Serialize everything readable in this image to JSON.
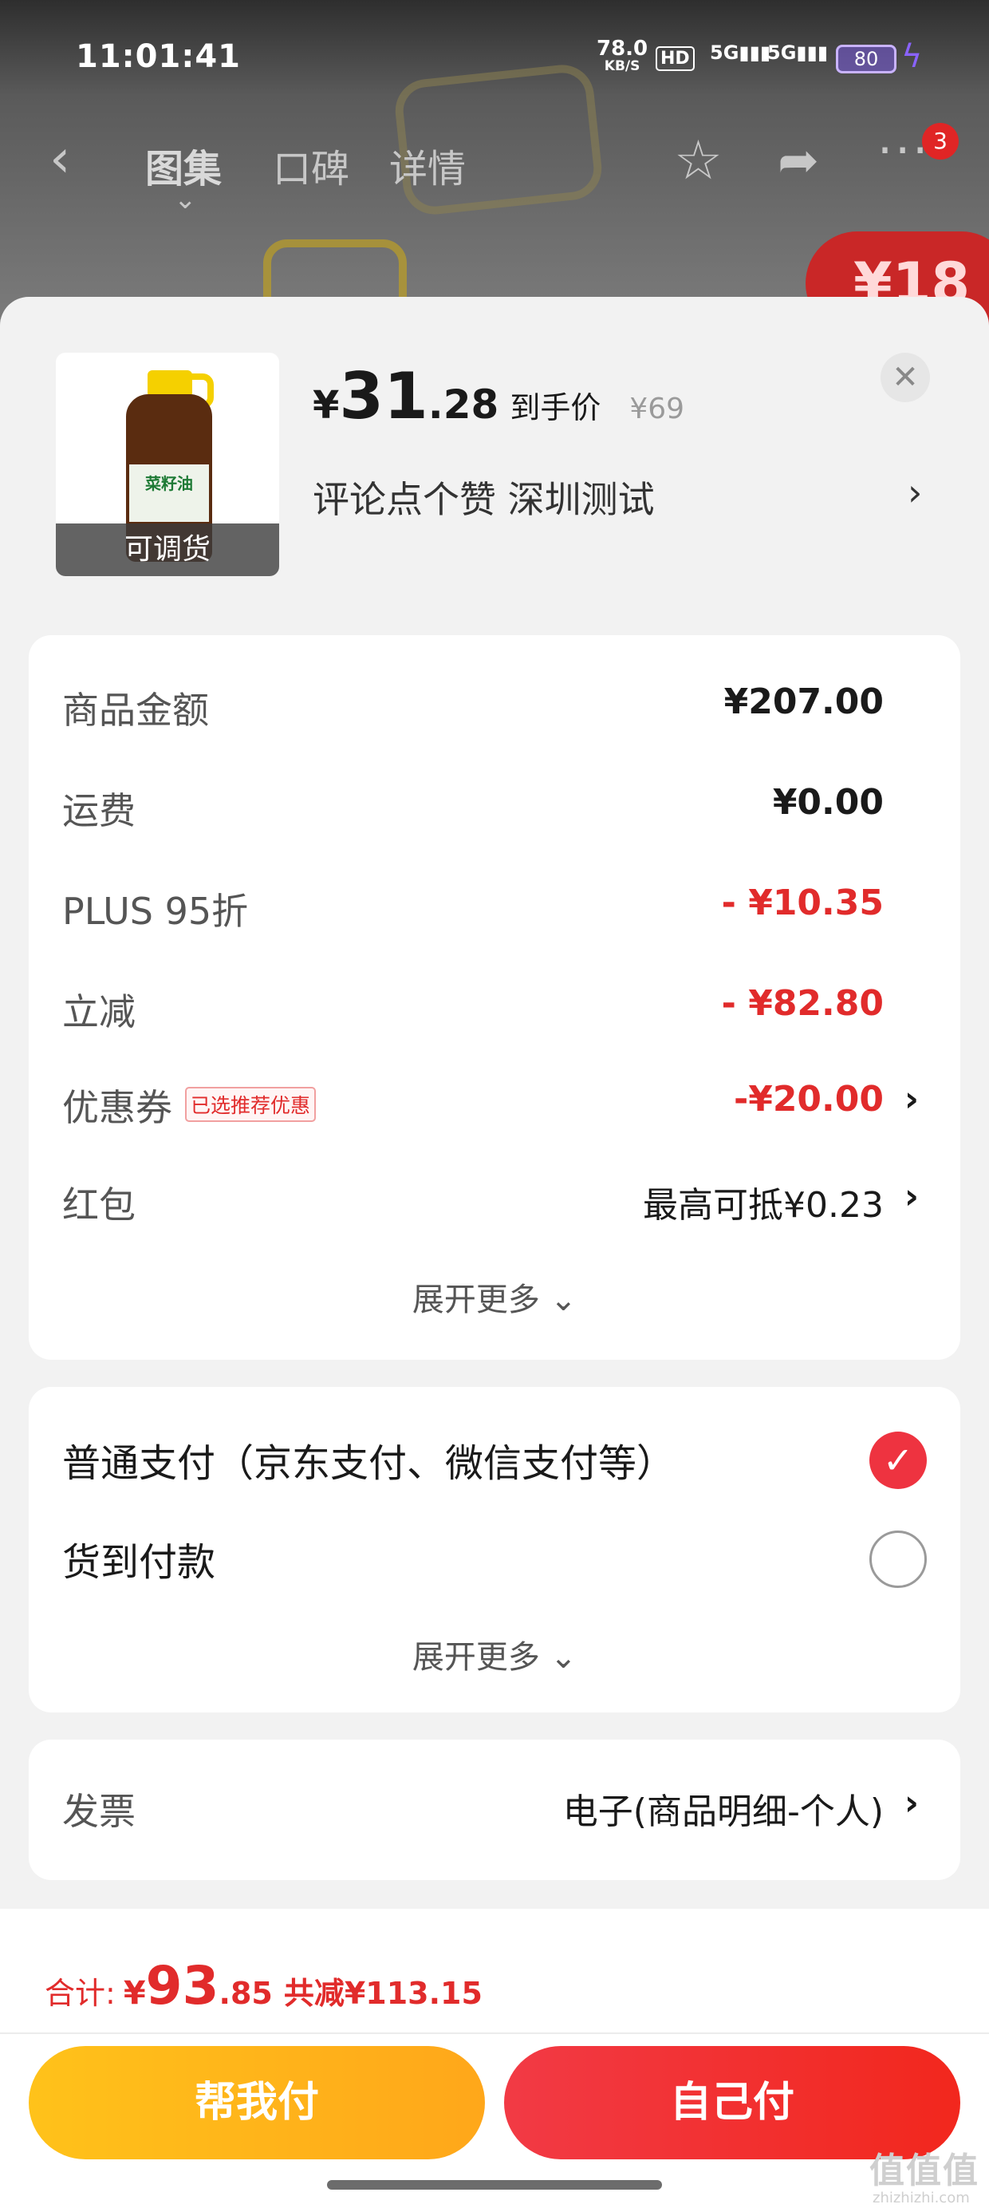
{
  "status_bar": {
    "time": "11:01:41",
    "net_speed": "78.0",
    "net_unit": "KB/S",
    "hd": "HD",
    "signal1": "5G",
    "signal2": "5G",
    "battery": "80"
  },
  "nav": {
    "tabs": [
      {
        "label": "图集"
      },
      {
        "label": "口碑"
      },
      {
        "label": "详情"
      }
    ],
    "badge_count": "3",
    "bg_promo": "¥18"
  },
  "product": {
    "thumb_caption": "可调货",
    "thumb_brand": "菜籽油",
    "price_symbol": "¥",
    "price_int": "31",
    "price_dec": ".28",
    "price_tag": "到手价",
    "original_price": "¥69",
    "address": "评论点个赞  深圳测试"
  },
  "breakdown": {
    "rows": [
      {
        "label": "商品金额",
        "value": "¥207.00"
      },
      {
        "label": "运费",
        "value": "¥0.00"
      },
      {
        "label": "PLUS 95折",
        "value": "- ¥10.35"
      },
      {
        "label": "立减",
        "value": "- ¥82.80"
      },
      {
        "label": "优惠券",
        "badge": "已选推荐优惠",
        "value": "-¥20.00"
      },
      {
        "label": "红包",
        "value": "最高可抵¥0.23"
      }
    ],
    "expand_label": "展开更多"
  },
  "payment": {
    "options": [
      {
        "label": "普通支付（京东支付、微信支付等）",
        "selected": true
      },
      {
        "label": "货到付款",
        "selected": false
      }
    ],
    "expand_label": "展开更多"
  },
  "invoice": {
    "label": "发票",
    "value": "电子(商品明细-个人)"
  },
  "footer": {
    "total_label": "合计:",
    "total_symbol": "¥",
    "total_int": "93",
    "total_dec": ".85",
    "total_saved": "共减¥113.15",
    "help_pay_label": "帮我付",
    "self_pay_label": "自己付"
  },
  "watermark": {
    "text": "值值值",
    "sub": "zhizhizhi.com"
  },
  "colors": {
    "accent_red": "#e12b2b",
    "help_button_yellow": "#ffb21a",
    "self_button_red": "#f2303a",
    "sheet_background": "#f2f2f2"
  },
  "icons": [
    "back-arrow-icon",
    "star-icon",
    "share-icon",
    "more-icon",
    "close-icon",
    "chevron-right-icon",
    "chevron-down-icon",
    "check-icon",
    "battery-icon",
    "charging-icon"
  ]
}
